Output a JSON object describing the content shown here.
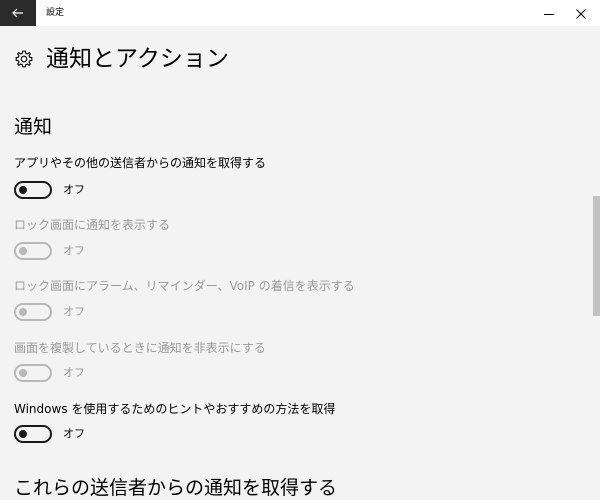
{
  "window": {
    "app_title": "設定",
    "back_icon": "back-arrow-icon",
    "minimize_icon": "minimize-icon",
    "close_icon": "close-icon"
  },
  "page": {
    "title": "通知とアクション",
    "icon": "gear-icon"
  },
  "notifications": {
    "section_title": "通知",
    "settings": [
      {
        "label": "アプリやその他の送信者からの通知を取得する",
        "state": "オフ",
        "enabled": true,
        "on": false
      },
      {
        "label": "ロック画面に通知を表示する",
        "state": "オフ",
        "enabled": false,
        "on": false
      },
      {
        "label": "ロック画面にアラーム、リマインダー、VoIP の着信を表示する",
        "state": "オフ",
        "enabled": false,
        "on": false
      },
      {
        "label": "画面を複製しているときに通知を非表示にする",
        "state": "オフ",
        "enabled": false,
        "on": false
      },
      {
        "label": "Windows を使用するためのヒントやおすすめの方法を取得",
        "state": "オフ",
        "enabled": true,
        "on": false
      }
    ]
  },
  "senders": {
    "section_title": "これらの送信者からの通知を取得する"
  },
  "colors": {
    "titlebar_back_bg": "#2b2b2b",
    "background": "#f3f3f3",
    "disabled_text": "#9a9a9a"
  }
}
